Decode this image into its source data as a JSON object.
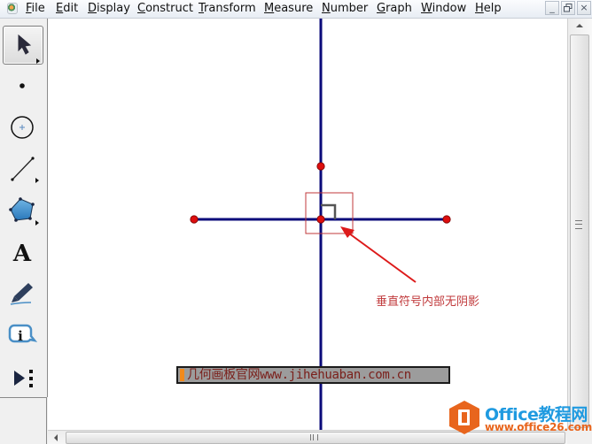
{
  "menubar": {
    "items": [
      {
        "label": "File",
        "mnemonic": "F",
        "rest": "ile"
      },
      {
        "label": "Edit",
        "mnemonic": "E",
        "rest": "dit"
      },
      {
        "label": "Display",
        "mnemonic": "D",
        "rest": "isplay"
      },
      {
        "label": "Construct",
        "mnemonic": "C",
        "rest": "onstruct"
      },
      {
        "label": "Transform",
        "mnemonic": "T",
        "rest": "ransform"
      },
      {
        "label": "Measure",
        "mnemonic": "M",
        "rest": "easure"
      },
      {
        "label": "Number",
        "mnemonic": "N",
        "rest": "umber"
      },
      {
        "label": "Graph",
        "mnemonic": "G",
        "rest": "raph"
      },
      {
        "label": "Window",
        "mnemonic": "W",
        "rest": "indow"
      },
      {
        "label": "Help",
        "mnemonic": "H",
        "rest": "elp"
      }
    ],
    "window_controls": {
      "minimize": "_",
      "restore": "🗗",
      "close": "×"
    }
  },
  "toolbox": {
    "tools": [
      {
        "name": "arrow-selection-tool",
        "icon": "arrow-icon",
        "selected": true,
        "has_submenu": true
      },
      {
        "name": "point-tool",
        "icon": "point-icon",
        "selected": false,
        "has_submenu": false
      },
      {
        "name": "compass-tool",
        "icon": "circle-icon",
        "selected": false,
        "has_submenu": false
      },
      {
        "name": "straightedge-tool",
        "icon": "segment-icon",
        "selected": false,
        "has_submenu": true
      },
      {
        "name": "polygon-tool",
        "icon": "pentagon-icon",
        "selected": false,
        "has_submenu": true
      },
      {
        "name": "text-tool",
        "icon": "text-A-icon",
        "glyph": "A",
        "selected": false,
        "has_submenu": false
      },
      {
        "name": "marker-tool",
        "icon": "marker-pen-icon",
        "selected": false,
        "has_submenu": false
      },
      {
        "name": "information-tool",
        "icon": "info-bubble-icon",
        "glyph": "i",
        "selected": false,
        "has_submenu": false
      },
      {
        "name": "custom-tool",
        "icon": "custom-tools-icon",
        "selected": false,
        "has_submenu": false
      }
    ]
  },
  "canvas": {
    "line_color": "#0a0a7a",
    "point_color": "#dd0e0e",
    "highlight_color": "#c0393b",
    "right_angle_mark_color": "#555555",
    "annotation_text": "垂直符号内部无阴影"
  },
  "watermark": {
    "text": "几何画板官网www.jihehuaban.com.cn"
  },
  "logo": {
    "brand": "Office教程网",
    "url": "www.office26.com",
    "brand_color": "#1f9ae0",
    "accent_color": "#e8651d"
  }
}
